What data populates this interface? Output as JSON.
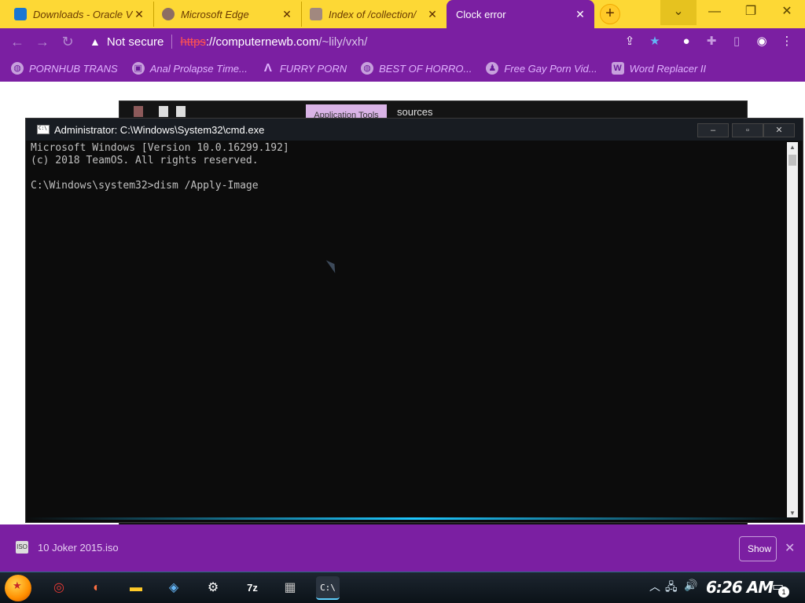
{
  "browser": {
    "tabs": [
      {
        "title": "Downloads - Oracle V",
        "favicon": "virtualbox-favicon",
        "fav_color": "#1976d2"
      },
      {
        "title": "Microsoft Edge",
        "favicon": "edge-favicon",
        "fav_color": "#8d6e63"
      },
      {
        "title": "Index of /collection/",
        "favicon": "page-favicon",
        "fav_color": "#a1887f"
      },
      {
        "title": "Clock error",
        "favicon": "",
        "fav_color": ""
      }
    ],
    "new_tab_symbol": "+",
    "address": {
      "security_label": "Not secure",
      "scheme": "https",
      "host": "://computernewb.com",
      "path": "/~lily/vxh/"
    },
    "bookmarks": [
      {
        "label": "PORNHUB TRANS",
        "icon": "globe-icon"
      },
      {
        "label": "Anal Prolapse Time...",
        "icon": "shape-icon"
      },
      {
        "label": "FURRY PORN",
        "icon": "letter-a-icon"
      },
      {
        "label": "BEST OF HORRO...",
        "icon": "globe-icon"
      },
      {
        "label": "Free Gay Porn Vid...",
        "icon": "figure-icon"
      },
      {
        "label": "Word Replacer II",
        "icon": "wr-icon"
      }
    ],
    "colors": {
      "tabbar": "#fdd835",
      "theme": "#7b1fa2"
    }
  },
  "explorer": {
    "ribbon_tab": "Application Tools",
    "folder": "sources"
  },
  "cmd": {
    "title": "Administrator: C:\\Windows\\System32\\cmd.exe",
    "lines": [
      "Microsoft Windows [Version 10.0.16299.192]",
      "(c) 2018 TeamOS. All rights reserved.",
      "",
      "C:\\Windows\\system32>dism /Apply-Image"
    ]
  },
  "downloads": {
    "filename": "10 Joker 2015.iso",
    "show_all": "Show all"
  },
  "taskbar": {
    "clock": "6:26 AM",
    "notifications": "1",
    "apps": [
      "chrome-icon",
      "firefox-icon",
      "file-explorer-icon",
      "virtualbox-icon",
      "settings-icon",
      "7zip-icon",
      "installer-icon",
      "cmd-icon"
    ]
  }
}
